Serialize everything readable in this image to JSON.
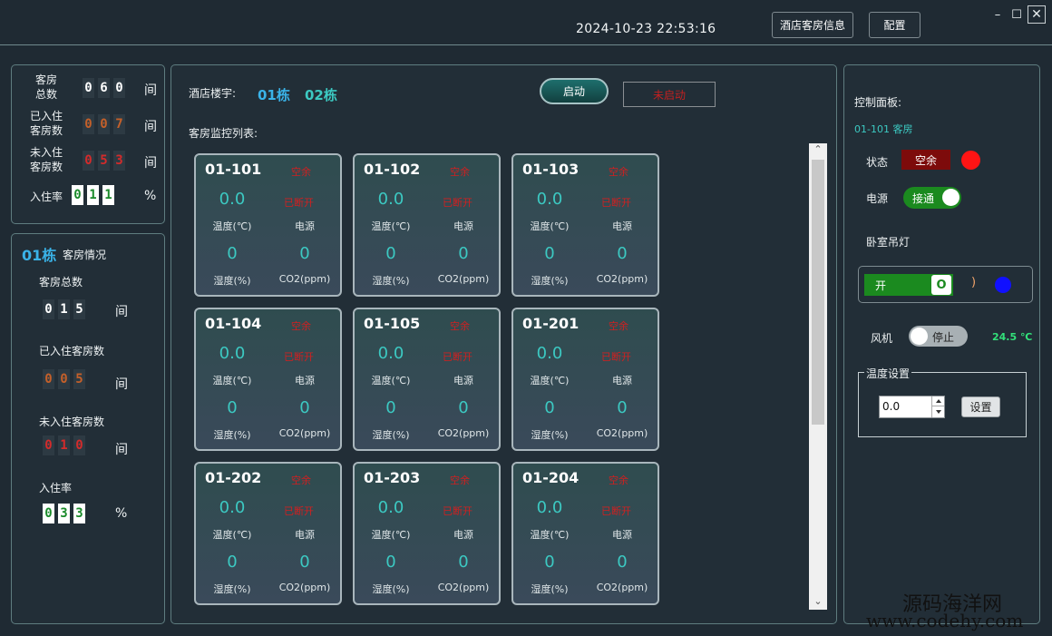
{
  "titlebar": {
    "datetime": "2024-10-23   22:53:16",
    "hotel_info_button": "酒店客房信息",
    "config_button": "配置",
    "minimize": "–",
    "maximize": "☐",
    "close": "✕"
  },
  "summary": {
    "total_label": "客房\n总数",
    "total_digits": [
      "0",
      "6",
      "0"
    ],
    "total_unit": "间",
    "occupied_label": "已入住\n客房数",
    "occupied_digits": [
      "0",
      "0",
      "7"
    ],
    "occupied_unit": "间",
    "vacant_label": "未入住\n客房数",
    "vacant_digits": [
      "0",
      "5",
      "3"
    ],
    "vacant_unit": "间",
    "rate_label": "入住率",
    "rate_digits": [
      "0",
      "1",
      "1"
    ],
    "rate_unit": "%"
  },
  "building": {
    "name": "01栋",
    "title": "客房情况",
    "total_label": "客房总数",
    "total_digits": [
      "0",
      "1",
      "5"
    ],
    "total_unit": "间",
    "occupied_label": "已入住客房数",
    "occupied_digits": [
      "0",
      "0",
      "5"
    ],
    "occupied_unit": "间",
    "vacant_label": "未入住客房数",
    "vacant_digits": [
      "0",
      "1",
      "0"
    ],
    "vacant_unit": "间",
    "rate_label": "入住率",
    "rate_digits": [
      "0",
      "3",
      "3"
    ],
    "rate_unit": "%"
  },
  "monitor": {
    "building_label": "酒店楼宇:",
    "buildings": [
      "01栋",
      "02栋"
    ],
    "start_button": "启动",
    "stop_button": "未启动",
    "list_label": "客房监控列表:",
    "rooms": [
      {
        "id": "01-101",
        "status": "空余",
        "power": "已断开",
        "temp": "0.0",
        "temp_label": "温度(℃)",
        "power_label": "电源",
        "humidity": "0",
        "co2": "0",
        "humidity_label": "湿度(%)",
        "co2_label": "CO2(ppm)"
      },
      {
        "id": "01-102",
        "status": "空余",
        "power": "已断开",
        "temp": "0.0",
        "temp_label": "温度(℃)",
        "power_label": "电源",
        "humidity": "0",
        "co2": "0",
        "humidity_label": "湿度(%)",
        "co2_label": "CO2(ppm)"
      },
      {
        "id": "01-103",
        "status": "空余",
        "power": "已断开",
        "temp": "0.0",
        "temp_label": "温度(℃)",
        "power_label": "电源",
        "humidity": "0",
        "co2": "0",
        "humidity_label": "湿度(%)",
        "co2_label": "CO2(ppm)"
      },
      {
        "id": "01-104",
        "status": "空余",
        "power": "已断开",
        "temp": "0.0",
        "temp_label": "温度(℃)",
        "power_label": "电源",
        "humidity": "0",
        "co2": "0",
        "humidity_label": "湿度(%)",
        "co2_label": "CO2(ppm)"
      },
      {
        "id": "01-105",
        "status": "空余",
        "power": "已断开",
        "temp": "0.0",
        "temp_label": "温度(℃)",
        "power_label": "电源",
        "humidity": "0",
        "co2": "0",
        "humidity_label": "湿度(%)",
        "co2_label": "CO2(ppm)"
      },
      {
        "id": "01-201",
        "status": "空余",
        "power": "已断开",
        "temp": "0.0",
        "temp_label": "温度(℃)",
        "power_label": "电源",
        "humidity": "0",
        "co2": "0",
        "humidity_label": "湿度(%)",
        "co2_label": "CO2(ppm)"
      },
      {
        "id": "01-202",
        "status": "空余",
        "power": "已断开",
        "temp": "0.0",
        "temp_label": "温度(℃)",
        "power_label": "电源",
        "humidity": "0",
        "co2": "0",
        "humidity_label": "湿度(%)",
        "co2_label": "CO2(ppm)"
      },
      {
        "id": "01-203",
        "status": "空余",
        "power": "已断开",
        "temp": "0.0",
        "temp_label": "温度(℃)",
        "power_label": "电源",
        "humidity": "0",
        "co2": "0",
        "humidity_label": "湿度(%)",
        "co2_label": "CO2(ppm)"
      },
      {
        "id": "01-204",
        "status": "空余",
        "power": "已断开",
        "temp": "0.0",
        "temp_label": "温度(℃)",
        "power_label": "电源",
        "humidity": "0",
        "co2": "0",
        "humidity_label": "湿度(%)",
        "co2_label": "CO2(ppm)"
      }
    ],
    "scroll_up": "⌃",
    "scroll_down": "⌄"
  },
  "control": {
    "title": "控制面板:",
    "room": "01-101 客房",
    "status_label": "状态",
    "status_value": "空余",
    "power_label": "电源",
    "power_value": "接通",
    "light_label": "卧室吊灯",
    "light_value": "开",
    "light_knob": "O",
    "light_mark": ")",
    "fan_label": "风机",
    "fan_value": "停止",
    "current_temp": "24.5 ℃",
    "temp_setting_label": "温度设置",
    "temp_input": "0.0",
    "set_button": "设置"
  },
  "watermark": {
    "line1": "源码海洋网",
    "line2": "www.codehy.com"
  },
  "colors": {
    "accent_cyan": "#3cc9c2",
    "status_red": "#d02020",
    "toggle_green": "#1b8a1f",
    "indicator_red": "#ff1414",
    "indicator_blue": "#1010ff"
  }
}
